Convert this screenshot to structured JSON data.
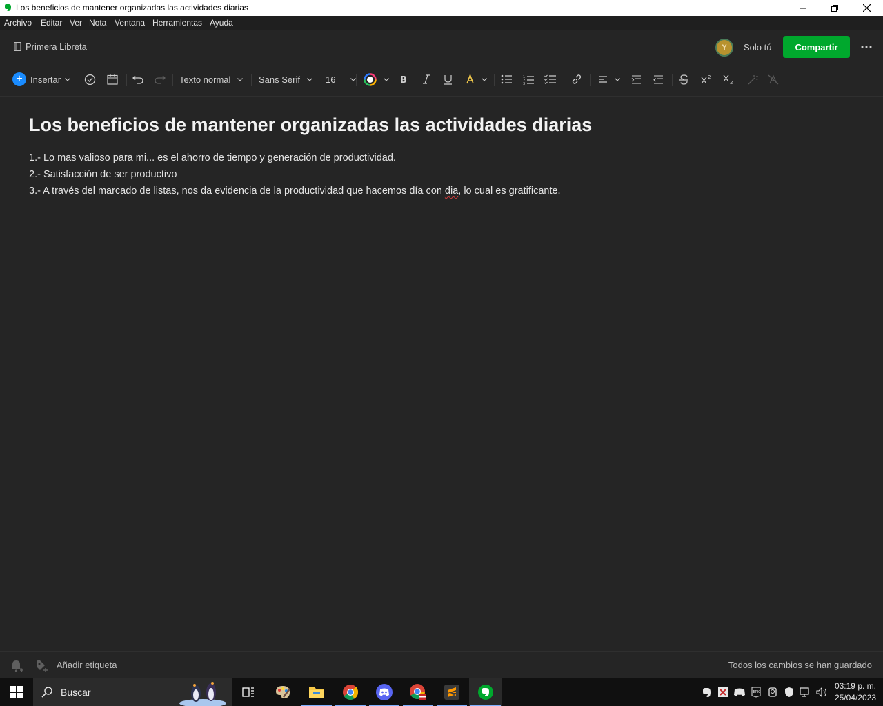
{
  "window": {
    "title": "Los beneficios de mantener organizadas las actividades diarias"
  },
  "menu": [
    "Archivo",
    "Editar",
    "Ver",
    "Nota",
    "Ventana",
    "Herramientas",
    "Ayuda"
  ],
  "header": {
    "notebook": "Primera Libreta",
    "avatar_initial": "Y",
    "sharing_status": "Solo tú",
    "share_button": "Compartir"
  },
  "toolbar": {
    "insert_label": "Insertar",
    "text_style": "Texto normal",
    "font_family": "Sans Serif",
    "font_size": "16"
  },
  "note": {
    "title": "Los beneficios de mantener organizadas las actividades diarias",
    "line1": "1.- Lo mas valioso para mi... es el ahorro de tiempo y generación de productividad.",
    "line2": "2.- Satisfacción de ser productivo",
    "line3_before": "3.- A través del marcado de listas, nos da evidencia de la productividad que hacemos día con ",
    "line3_misspelled": "dia",
    "line3_after": ", lo cual es gratificante."
  },
  "footer": {
    "add_tag": "Añadir etiqueta",
    "save_status": "Todos los cambios se han guardado"
  },
  "taskbar": {
    "search_placeholder": "Buscar",
    "time": "03:19 p. m.",
    "date": "25/04/2023"
  },
  "colors": {
    "accent_green": "#00a82d",
    "insert_blue": "#1a8cff",
    "background": "#252525"
  }
}
